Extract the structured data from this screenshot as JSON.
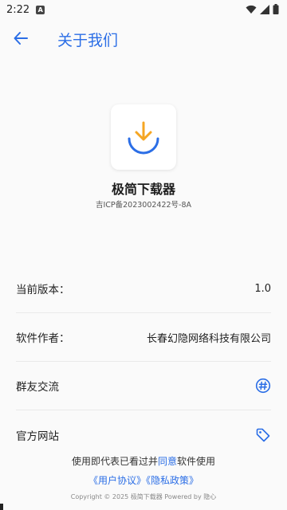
{
  "status_bar": {
    "time": "2:22",
    "notif_letter": "A"
  },
  "app_bar": {
    "title": "关于我们"
  },
  "app": {
    "name": "极简下载器",
    "icp": "吉ICP备2023002422号-8A",
    "accent_orange": "#f5a623",
    "accent_blue": "#2b6ee6"
  },
  "rows": [
    {
      "label": "当前版本：",
      "value": "1.0"
    },
    {
      "label": "软件作者：",
      "value": "长春幻隐网络科技有限公司"
    },
    {
      "label": "群友交流",
      "icon": "chat-hashtag-icon"
    },
    {
      "label": "官方网站",
      "icon": "tag-icon"
    }
  ],
  "footer": {
    "prefix": "使用即代表已看过并",
    "agree": "同意",
    "suffix": "软件使用",
    "user_agreement": "《用户协议》",
    "privacy_policy": "《隐私政策》",
    "copyright": "Copyright © 2025 极简下载器 Powered by 隐心"
  }
}
